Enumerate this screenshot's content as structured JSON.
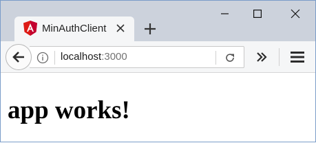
{
  "window": {
    "controls": {
      "minimize_icon": "minimize-icon",
      "maximize_icon": "maximize-icon",
      "close_icon": "close-icon"
    }
  },
  "tab": {
    "title": "MinAuthClient",
    "favicon": "angular-logo-icon",
    "favicon_color": "#dd1b16"
  },
  "new_tab_icon": "plus-icon",
  "navbar": {
    "url_host": "localhost",
    "url_port": ":3000",
    "back_icon": "back-arrow-icon",
    "info_icon": "info-icon",
    "reload_icon": "reload-icon",
    "overflow_icon": "double-chevron-right-icon",
    "menu_icon": "hamburger-menu-icon"
  },
  "content": {
    "heading": "app works!"
  },
  "colors": {
    "tabstrip": "#ccd2dc",
    "toolbar": "#f5f6f7",
    "window_border": "#7a9cc9"
  }
}
